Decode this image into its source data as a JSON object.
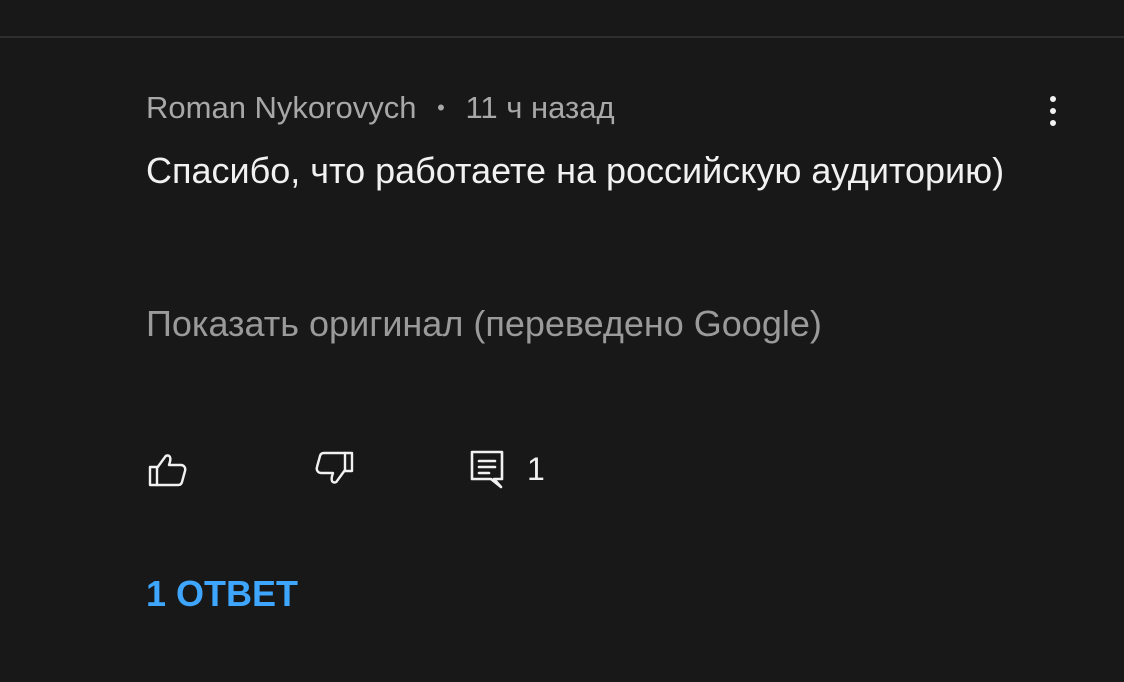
{
  "comment": {
    "author": "Roman Nykorovych",
    "separator": "•",
    "time": "11 ч назад",
    "text": "Спасибо, что работаете на российскую аудиторию)",
    "show_original": "Показать оригинал (переведено Google)",
    "reply_count": "1",
    "replies_label": "1 ОТВЕТ"
  },
  "icons": {
    "menu": "more-vertical-icon",
    "like": "thumbs-up-icon",
    "dislike": "thumbs-down-icon",
    "reply": "comment-icon"
  },
  "colors": {
    "background": "#181818",
    "primary_text": "#f1f1f1",
    "secondary_text": "#a8a8a8",
    "link_accent": "#3ea6ff"
  }
}
